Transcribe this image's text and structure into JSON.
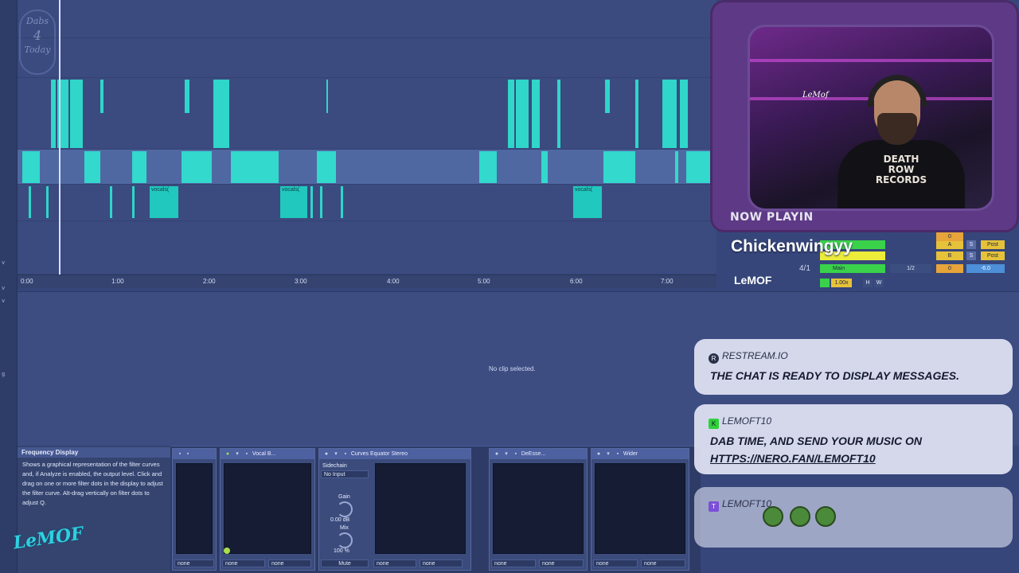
{
  "arrangement": {
    "ruler_ticks": [
      "0:00",
      "1:00",
      "2:00",
      "3:00",
      "4:00",
      "5:00",
      "6:00",
      "7:00"
    ],
    "clip_labels": [
      "vocals(",
      "vocals(",
      "vocals("
    ]
  },
  "logo_badge": {
    "line1": "Dabs",
    "line2": "4",
    "line3": "Today"
  },
  "clip_detail": {
    "empty_text": "No clip selected."
  },
  "info_panel": {
    "title": "Frequency Display",
    "body": "Shows a graphical representation of the filter curves and, if Analyze is enabled, the output level. Click and drag on one or more filter dots in the display to adjust the filter curve. Alt-drag vertically on filter dots to adjust Q.",
    "logo_text": "LeMOF"
  },
  "devices": {
    "d1": {
      "foot": [
        "none",
        "none"
      ]
    },
    "d2": {
      "name": "Vocal B...",
      "foot": [
        "none",
        "none"
      ]
    },
    "d3": {
      "name": "Curves Equator Stereo",
      "sidechain_label": "Sidechain",
      "sidechain_value": "No Input",
      "gain_label": "Gain",
      "gain_value": "0.00 dB",
      "mix_label": "Mix",
      "mix_value": "100 %",
      "mute_label": "Mute",
      "foot": [
        "none",
        "none"
      ]
    },
    "d4": {
      "name": "DeEsse...",
      "foot": [
        "none",
        "none"
      ]
    },
    "d5": {
      "name": "Wider",
      "foot": [
        "none",
        "none"
      ]
    }
  },
  "webcam": {
    "now_playing_label": "NOW PLAYIN",
    "shirt_text": "DEATH ROW RECORDS",
    "sign_text": "LeMof"
  },
  "now_playing": {
    "track": "Chickenwingyy",
    "artist": "LeMOF"
  },
  "mixer": {
    "ratio": "4/1",
    "main_label": "Main",
    "a": "A",
    "b": "B",
    "s1": "S",
    "s2": "S",
    "post1": "Post",
    "post2": "Post",
    "half": "1/2",
    "zero1": "0",
    "zero2": "0",
    "db": "-6.0",
    "zoom": "1.00x",
    "h": "H",
    "w": "W"
  },
  "chat": {
    "m1": {
      "source": "RESTREAM.IO",
      "text": "THE CHAT IS READY TO DISPLAY MESSAGES."
    },
    "m2": {
      "source": "LEMOFT10",
      "text_line1": "DAB TIME, AND SEND YOUR MUSIC ON",
      "link": "HTTPS://NERO.FAN/LEMOFT10"
    },
    "m3": {
      "source": "LEMOFT10"
    }
  },
  "colors": {
    "clip": "#2fe6d0",
    "accent": "#5068a2",
    "background": "#36467a"
  }
}
